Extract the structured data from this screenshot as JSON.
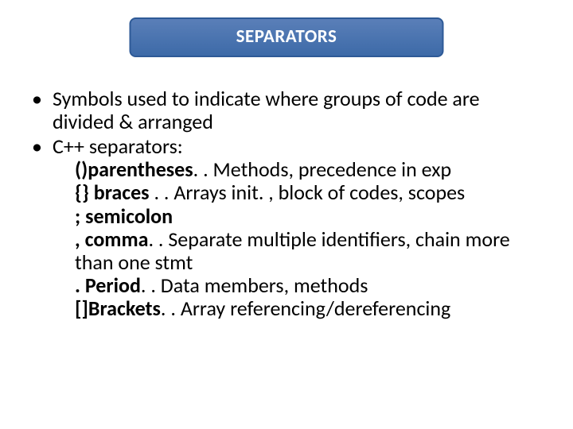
{
  "title": "SEPARATORS",
  "bullets": [
    "Symbols used to indicate where groups of code are divided & arranged",
    "C++ separators:"
  ],
  "items": [
    {
      "sym": "()",
      "name": "parentheses",
      "sep": ". .",
      "desc": "Methods, precedence in exp"
    },
    {
      "sym": "{}",
      "name": " braces",
      "sep": " . . ",
      "desc": "Arrays init. , block of codes, scopes"
    },
    {
      "sym": ";",
      "name": " semicolon",
      "sep": "",
      "desc": ""
    },
    {
      "sym": ",",
      "name": " comma",
      "sep": ". . ",
      "desc": "Separate multiple identifiers, chain more than one stmt"
    },
    {
      "sym": ".",
      "name": " Period",
      "sep": ". . ",
      "desc": "Data members, methods"
    },
    {
      "sym": "[]",
      "name": "Brackets",
      "sep": ". . ",
      "desc": "Array referencing/dereferencing"
    }
  ]
}
